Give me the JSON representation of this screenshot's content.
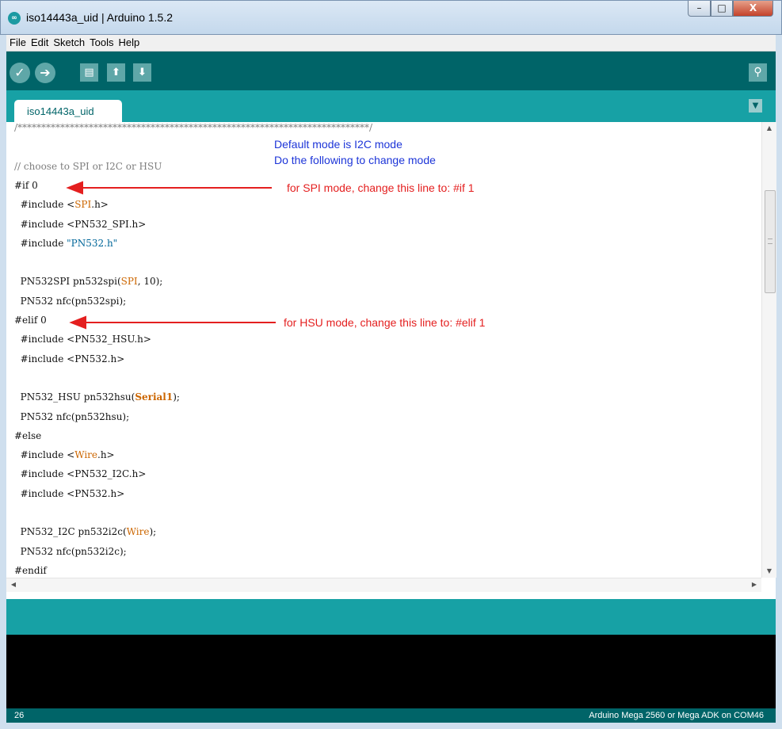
{
  "window": {
    "title": "iso14443a_uid | Arduino 1.5.2",
    "app_icon": "arduino-logo-icon",
    "controls": {
      "minimize": "–",
      "maximize": "□",
      "close": "X"
    }
  },
  "menu": {
    "items": [
      {
        "label": "File"
      },
      {
        "label": "Edit"
      },
      {
        "label": "Sketch"
      },
      {
        "label": "Tools"
      },
      {
        "label": "Help"
      }
    ]
  },
  "toolbar": {
    "buttons": [
      {
        "name": "verify",
        "icon": "checkmark-icon",
        "glyph": "✓"
      },
      {
        "name": "upload",
        "icon": "arrow-right-icon",
        "glyph": "➔"
      },
      {
        "name": "new",
        "icon": "new-file-icon",
        "glyph": "▤"
      },
      {
        "name": "open",
        "icon": "arrow-up-icon",
        "glyph": "⬆"
      },
      {
        "name": "save",
        "icon": "arrow-down-icon",
        "glyph": "⬇"
      }
    ],
    "serial_monitor": {
      "icon": "magnifier-icon",
      "glyph": "⚲"
    }
  },
  "tabs": [
    {
      "label": "iso14443a_uid"
    }
  ],
  "tab_menu_glyph": "▼",
  "editor": {
    "lines": [
      {
        "text": "/**************************************************************************/",
        "kind": "comment"
      },
      {
        "text": "",
        "kind": "plain"
      },
      {
        "text": "// choose to SPI or I2C or HSU",
        "kind": "comment"
      },
      {
        "text": "#if 0",
        "kind": "plain"
      },
      {
        "text": "  #include <SPI.h>",
        "kind": "plain"
      },
      {
        "text": "  #include <PN532_SPI.h>",
        "kind": "plain"
      },
      {
        "text": "  #include \"PN532.h\"",
        "kind": "plain"
      },
      {
        "text": "",
        "kind": "plain"
      },
      {
        "text": "  PN532SPI pn532spi(SPI, 10);",
        "kind": "plain"
      },
      {
        "text": "  PN532 nfc(pn532spi);",
        "kind": "plain"
      },
      {
        "text": "#elif 0",
        "kind": "plain"
      },
      {
        "text": "  #include <PN532_HSU.h>",
        "kind": "plain"
      },
      {
        "text": "  #include <PN532.h>",
        "kind": "plain"
      },
      {
        "text": "",
        "kind": "plain"
      },
      {
        "text": "  PN532_HSU pn532hsu(Serial1);",
        "kind": "plain"
      },
      {
        "text": "  PN532 nfc(pn532hsu);",
        "kind": "plain"
      },
      {
        "text": "#else",
        "kind": "plain"
      },
      {
        "text": "  #include <Wire.h>",
        "kind": "plain"
      },
      {
        "text": "  #include <PN532_I2C.h>",
        "kind": "plain"
      },
      {
        "text": "  #include <PN532.h>",
        "kind": "plain"
      },
      {
        "text": "",
        "kind": "plain"
      },
      {
        "text": "  PN532_I2C pn532i2c(Wire);",
        "kind": "plain"
      },
      {
        "text": "  PN532 nfc(pn532i2c);",
        "kind": "plain"
      },
      {
        "text": "#endif",
        "kind": "plain"
      }
    ],
    "scroll_arrows": {
      "up": "▲",
      "down": "▼",
      "left": "◀",
      "right": "▶"
    }
  },
  "annotations": {
    "default_mode": "Default mode is I2C mode",
    "change_mode": "Do the following to change mode",
    "spi_note": "for SPI mode, change this line to: #if 1",
    "hsu_note": "for HSU mode, change this line to: #elif 1",
    "color_red": "#e41f1f",
    "color_blue": "#1d35d8"
  },
  "status": {
    "line_number": "26",
    "board": "Arduino Mega 2560 or Mega ADK on COM46"
  },
  "colors": {
    "toolbar": "#006468",
    "tab_strip": "#17a1a5",
    "console": "#000000"
  }
}
